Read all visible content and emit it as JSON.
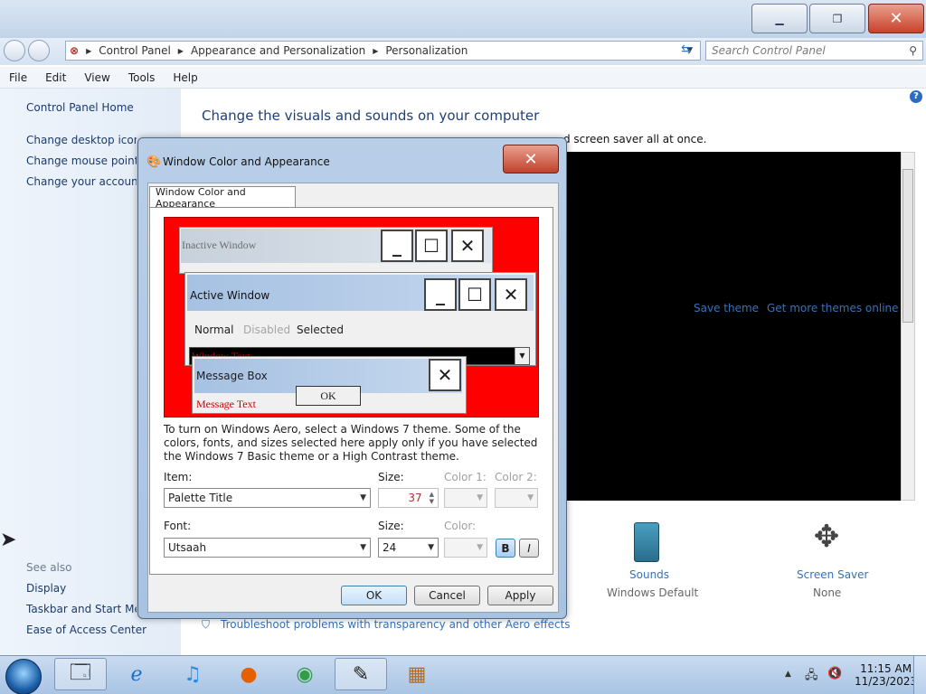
{
  "window": {
    "caption_buttons": {
      "minimize": "▁",
      "maximize": "❐",
      "close": "✕"
    }
  },
  "address": {
    "crumbs": [
      "Control Panel",
      "Appearance and Personalization",
      "Personalization"
    ],
    "search_placeholder": "Search Control Panel"
  },
  "menu": [
    "File",
    "Edit",
    "View",
    "Tools",
    "Help"
  ],
  "left_pane": {
    "home": "Control Panel Home",
    "links": [
      "Change desktop icons",
      "Change mouse pointer",
      "Change your account p"
    ],
    "see_also_title": "See also",
    "see_also": [
      "Display",
      "Taskbar and Start Menu",
      "Ease of Access Center"
    ]
  },
  "main": {
    "title": "Change the visuals and sounds on your computer",
    "description_fragment": "d screen saver all at once.",
    "save_theme": "Save theme",
    "get_more_themes": "Get more themes online",
    "sounds_label": "Sounds",
    "sounds_value": "Windows Default",
    "screensaver_label": "Screen Saver",
    "screensaver_value": "None",
    "troubleshoot": "Troubleshoot problems with transparency and other Aero effects"
  },
  "dialog": {
    "title": "Window Color and Appearance",
    "tab": "Window Color and Appearance",
    "preview": {
      "inactive": "Inactive Window",
      "active": "Active Window",
      "menu_normal": "Normal",
      "menu_disabled": "Disabled",
      "menu_selected": "Selected",
      "window_text": "Window Text",
      "message_box": "Message Box",
      "message_text": "Message Text",
      "ok": "OK"
    },
    "info": "To turn on Windows Aero, select a Windows 7 theme.  Some of the colors, fonts, and sizes selected here apply only if you have selected the Windows 7 Basic theme or a High Contrast theme.",
    "item_label": "Item:",
    "item_value": "Palette Title",
    "size_label": "Size:",
    "size_value": "37",
    "color1_label": "Color 1:",
    "color2_label": "Color 2:",
    "font_label": "Font:",
    "font_value": "Utsaah",
    "font_size_label": "Size:",
    "font_size_value": "24",
    "font_color_label": "Color:",
    "bold": "B",
    "italic": "I",
    "ok": "OK",
    "cancel": "Cancel",
    "apply": "Apply"
  },
  "taskbar": {
    "time": "11:15 AM",
    "date": "11/23/2023"
  },
  "colors": {
    "link": "#1c3b6b",
    "accent_blue": "#3772b8",
    "preview_red": "#ff0000",
    "close_red": "#c8412a"
  }
}
